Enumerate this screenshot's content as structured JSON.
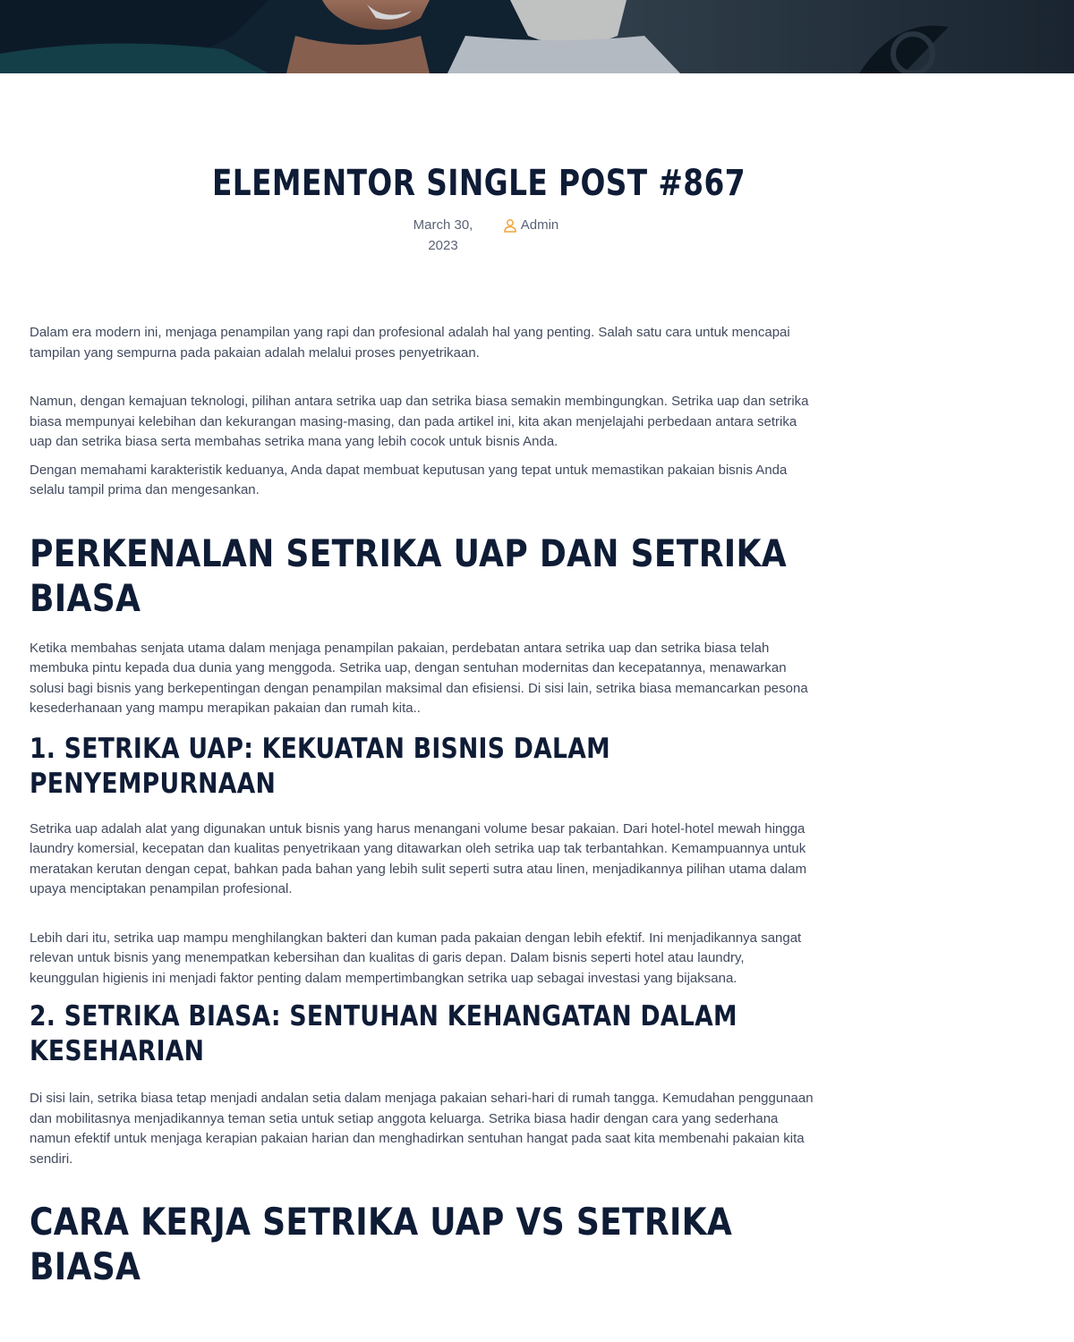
{
  "post": {
    "title": "ELEMENTOR SINGLE POST #867",
    "date": "March 30, 2023",
    "author": "Admin",
    "author_icon": "user-icon"
  },
  "colors": {
    "heading": "#0f1c36",
    "body_text": "#424a5e",
    "accent_icon": "#f2a33a"
  },
  "content": {
    "intro_p1": "Dalam era modern ini, menjaga penampilan yang rapi dan profesional adalah hal yang penting. Salah satu cara untuk mencapai tampilan yang sempurna pada pakaian adalah melalui proses penyetrikaan.",
    "intro_p2": "Namun, dengan kemajuan teknologi, pilihan antara setrika uap dan setrika biasa semakin membingungkan. Setrika uap dan setrika biasa mempunyai kelebihan dan kekurangan masing-masing, dan pada artikel ini, kita akan menjelajahi perbedaan antara setrika uap dan setrika biasa serta membahas setrika mana yang lebih cocok untuk bisnis Anda.",
    "intro_p3": "Dengan memahami karakteristik keduanya, Anda dapat membuat keputusan yang tepat untuk memastikan pakaian bisnis Anda selalu tampil prima dan mengesankan.",
    "section1_heading": "PERKENALAN SETRIKA UAP DAN SETRIKA BIASA",
    "section1_p1": "Ketika membahas senjata utama dalam menjaga penampilan pakaian, perdebatan antara setrika uap dan setrika biasa telah membuka pintu kepada dua dunia yang menggoda. Setrika uap, dengan sentuhan modernitas dan kecepatannya, menawarkan solusi bagi bisnis yang berkepentingan dengan penampilan maksimal dan efisiensi. Di sisi lain, setrika biasa memancarkan pesona kesederhanaan yang mampu merapikan pakaian dan rumah kita..",
    "sub1_heading": "1. SETRIKA UAP: KEKUATAN BISNIS DALAM PENYEMPURNAAN",
    "sub1_p1": "Setrika uap adalah alat yang digunakan untuk bisnis yang harus menangani volume besar pakaian. Dari hotel-hotel mewah hingga laundry komersial, kecepatan dan kualitas penyetrikaan yang ditawarkan oleh setrika uap tak terbantahkan. Kemampuannya untuk meratakan kerutan dengan cepat, bahkan pada bahan yang lebih sulit seperti sutra atau linen, menjadikannya pilihan utama dalam upaya menciptakan penampilan profesional.",
    "sub1_p2": "Lebih dari itu, setrika uap mampu menghilangkan bakteri dan kuman pada pakaian dengan lebih efektif. Ini menjadikannya sangat relevan untuk bisnis yang menempatkan kebersihan dan kualitas di garis depan. Dalam bisnis seperti hotel atau laundry, keunggulan higienis ini menjadi faktor penting dalam mempertimbangkan setrika uap sebagai investasi yang bijaksana.",
    "sub2_heading": "2. SETRIKA BIASA: SENTUHAN KEHANGATAN DALAM KESEHARIAN",
    "sub2_p1": "Di sisi lain, setrika biasa tetap menjadi andalan setia dalam menjaga pakaian sehari-hari di rumah tangga. Kemudahan penggunaan dan mobilitasnya menjadikannya teman setia untuk setiap anggota keluarga. Setrika biasa hadir dengan cara yang sederhana namun efektif untuk menjaga kerapian pakaian harian dan menghadirkan sentuhan hangat pada saat kita membenahi pakaian kita sendiri.",
    "section2_heading": "CARA KERJA SETRIKA UAP VS SETRIKA BIASA"
  }
}
